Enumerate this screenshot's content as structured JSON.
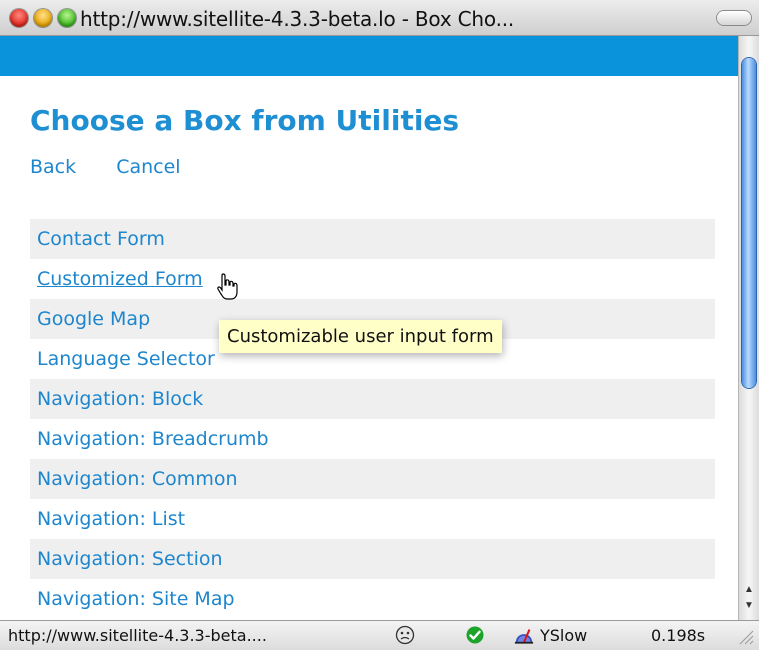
{
  "window": {
    "title": "http://www.sitellite-4.3.3-beta.lo - Box Cho..."
  },
  "page": {
    "title": "Choose a Box from Utilities",
    "links": {
      "back": "Back",
      "cancel": "Cancel"
    }
  },
  "boxes": [
    {
      "label": "Contact Form"
    },
    {
      "label": "Customized Form"
    },
    {
      "label": "Google Map"
    },
    {
      "label": "Language Selector"
    },
    {
      "label": "Navigation: Block"
    },
    {
      "label": "Navigation: Breadcrumb"
    },
    {
      "label": "Navigation: Common"
    },
    {
      "label": "Navigation: List"
    },
    {
      "label": "Navigation: Section"
    },
    {
      "label": "Navigation: Site Map"
    }
  ],
  "tooltip": {
    "text": "Customizable user input form"
  },
  "status": {
    "url": "http://www.sitellite-4.3.3-beta....",
    "yslow_label": "YSlow",
    "load_time": "0.198s"
  },
  "colors": {
    "accent_blue": "#0a92da",
    "link_blue": "#1e86cd",
    "row_alt": "#efefef",
    "tooltip_bg": "#ffffc8"
  },
  "icons": {
    "status_1": "face-icon",
    "status_2": "check-circle-icon",
    "status_3": "yslow-icon"
  }
}
